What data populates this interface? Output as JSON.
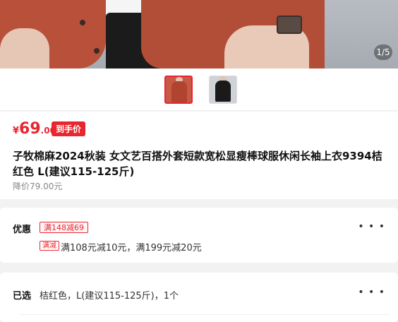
{
  "gallery": {
    "pager_current": "1",
    "pager_total": "5",
    "pager_text": "1/5"
  },
  "thumbnails": [
    {
      "name": "rust-red jacket thumbnail",
      "selected": true
    },
    {
      "name": "black jacket thumbnail",
      "selected": false
    }
  ],
  "product": {
    "currency": "¥",
    "price_int": "69",
    "price_dec": ".00",
    "price_badge": "到手价",
    "title": "子牧棉麻2024秋装 女文艺百搭外套短款宽松显瘦棒球服休闲长袖上衣9394桔红色 L(建议115-125斤)",
    "original_price": "降价79.00元"
  },
  "promo": {
    "label": "优惠",
    "coupon": "满148减69",
    "tag": "满减",
    "text": "满108元减10元，满199元减20元"
  },
  "selection": {
    "label": "已选",
    "value": "桔红色，L(建议115-125斤)，1个"
  },
  "colors": {
    "accent": "#e8262f",
    "page_bg": "#f2f2f2"
  },
  "icons": {
    "more": "more-dots-icon"
  }
}
